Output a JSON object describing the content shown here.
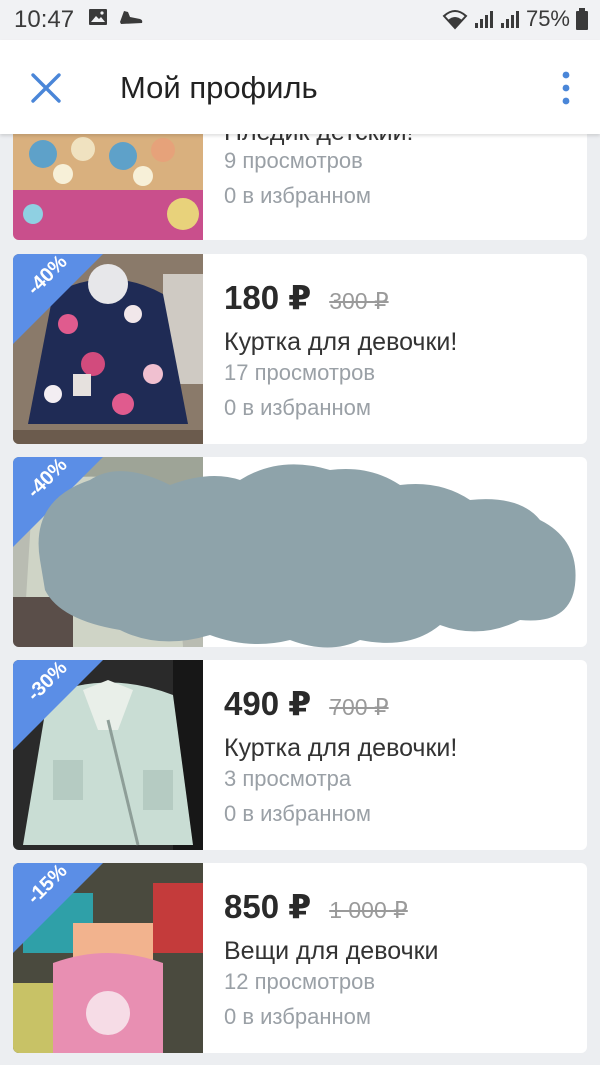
{
  "status_bar": {
    "time": "10:47",
    "battery": "75%",
    "icons": [
      "image-icon",
      "shoe-icon",
      "wifi-icon",
      "signal-icon",
      "signal-icon",
      "battery-icon"
    ]
  },
  "app_bar": {
    "title": "Мой профиль",
    "close_icon": "close-icon",
    "menu_icon": "more-vert-icon"
  },
  "colors": {
    "accent": "#4a86d8",
    "badge": "#5b8ee6",
    "redaction": "#8ea3aa",
    "background": "#eceef1"
  },
  "listings": [
    {
      "title": "Пледик детский!",
      "views": "9 просмотров",
      "favorites": "0 в избранном"
    },
    {
      "discount": "-40%",
      "price": "180 ₽",
      "old_price": "300 ₽",
      "title": "Куртка для девочки!",
      "views": "17 просмотров",
      "favorites": "0 в избранном"
    },
    {
      "discount": "-40%",
      "redacted": true
    },
    {
      "discount": "-30%",
      "price": "490 ₽",
      "old_price": "700 ₽",
      "title": "Куртка для девочки!",
      "views": "3 просмотра",
      "favorites": "0 в избранном"
    },
    {
      "discount": "-15%",
      "price": "850 ₽",
      "old_price": "1 000 ₽",
      "title": "Вещи для девочки",
      "views": "12 просмотров",
      "favorites": "0 в избранном"
    }
  ]
}
